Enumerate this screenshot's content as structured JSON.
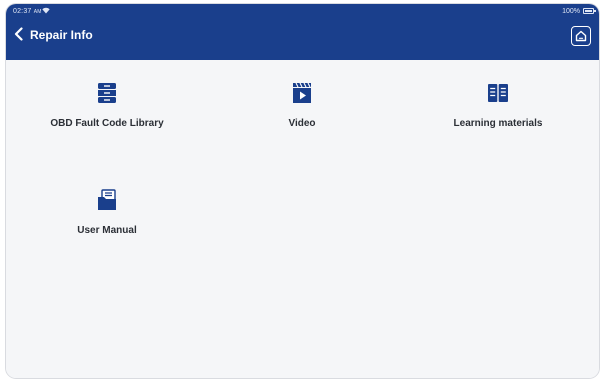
{
  "status_bar": {
    "time": "02:37",
    "period": "AM",
    "battery": "100%"
  },
  "header": {
    "title": "Repair Info",
    "back_icon": "chevron-left-icon",
    "home_icon": "home-icon"
  },
  "tiles": [
    {
      "label": "OBD Fault Code Library",
      "icon": "archive-drawer-icon"
    },
    {
      "label": "Video",
      "icon": "video-clapper-icon"
    },
    {
      "label": "Learning materials",
      "icon": "open-book-icon"
    },
    {
      "label": "User Manual",
      "icon": "folder-documents-icon"
    }
  ],
  "colors": {
    "header": "#1a3f8c",
    "icon": "#1a3f8c",
    "background": "#f5f6f8",
    "text": "#2b2f36"
  }
}
